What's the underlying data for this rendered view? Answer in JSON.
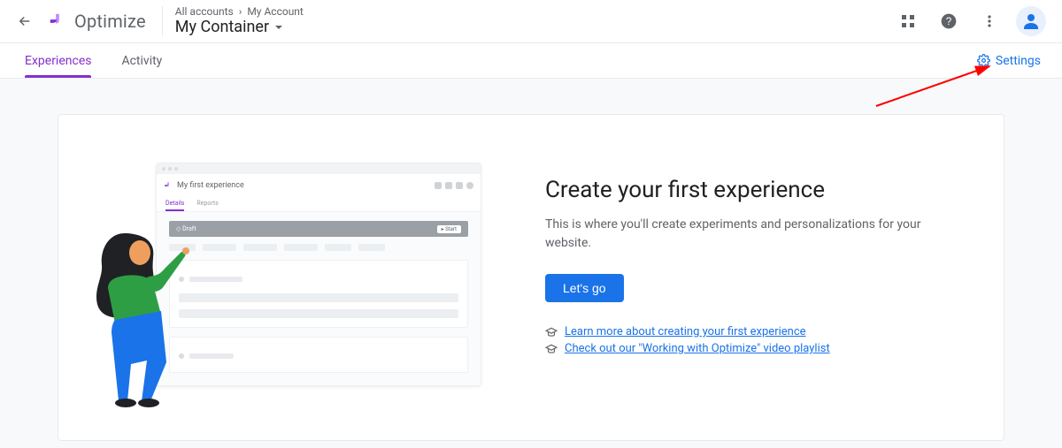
{
  "brand": {
    "name": "Optimize"
  },
  "breadcrumb": {
    "root": "All accounts",
    "account": "My Account"
  },
  "container": {
    "name": "My Container"
  },
  "tabs": {
    "items": [
      "Experiences",
      "Activity"
    ],
    "activeIndex": 0
  },
  "settings": {
    "label": "Settings"
  },
  "card": {
    "illustration": {
      "miniTitle": "My first experience",
      "miniTab1": "Details",
      "miniTab2": "Reports",
      "draftLabel": "Draft",
      "draftAction": "Start"
    },
    "heading": "Create your first experience",
    "description": "This is where you'll create experiments and personalizations for your website.",
    "cta": "Let's go",
    "links": [
      "Learn more about creating your first experience",
      "Check out our \"Working with Optimize\" video playlist"
    ]
  }
}
